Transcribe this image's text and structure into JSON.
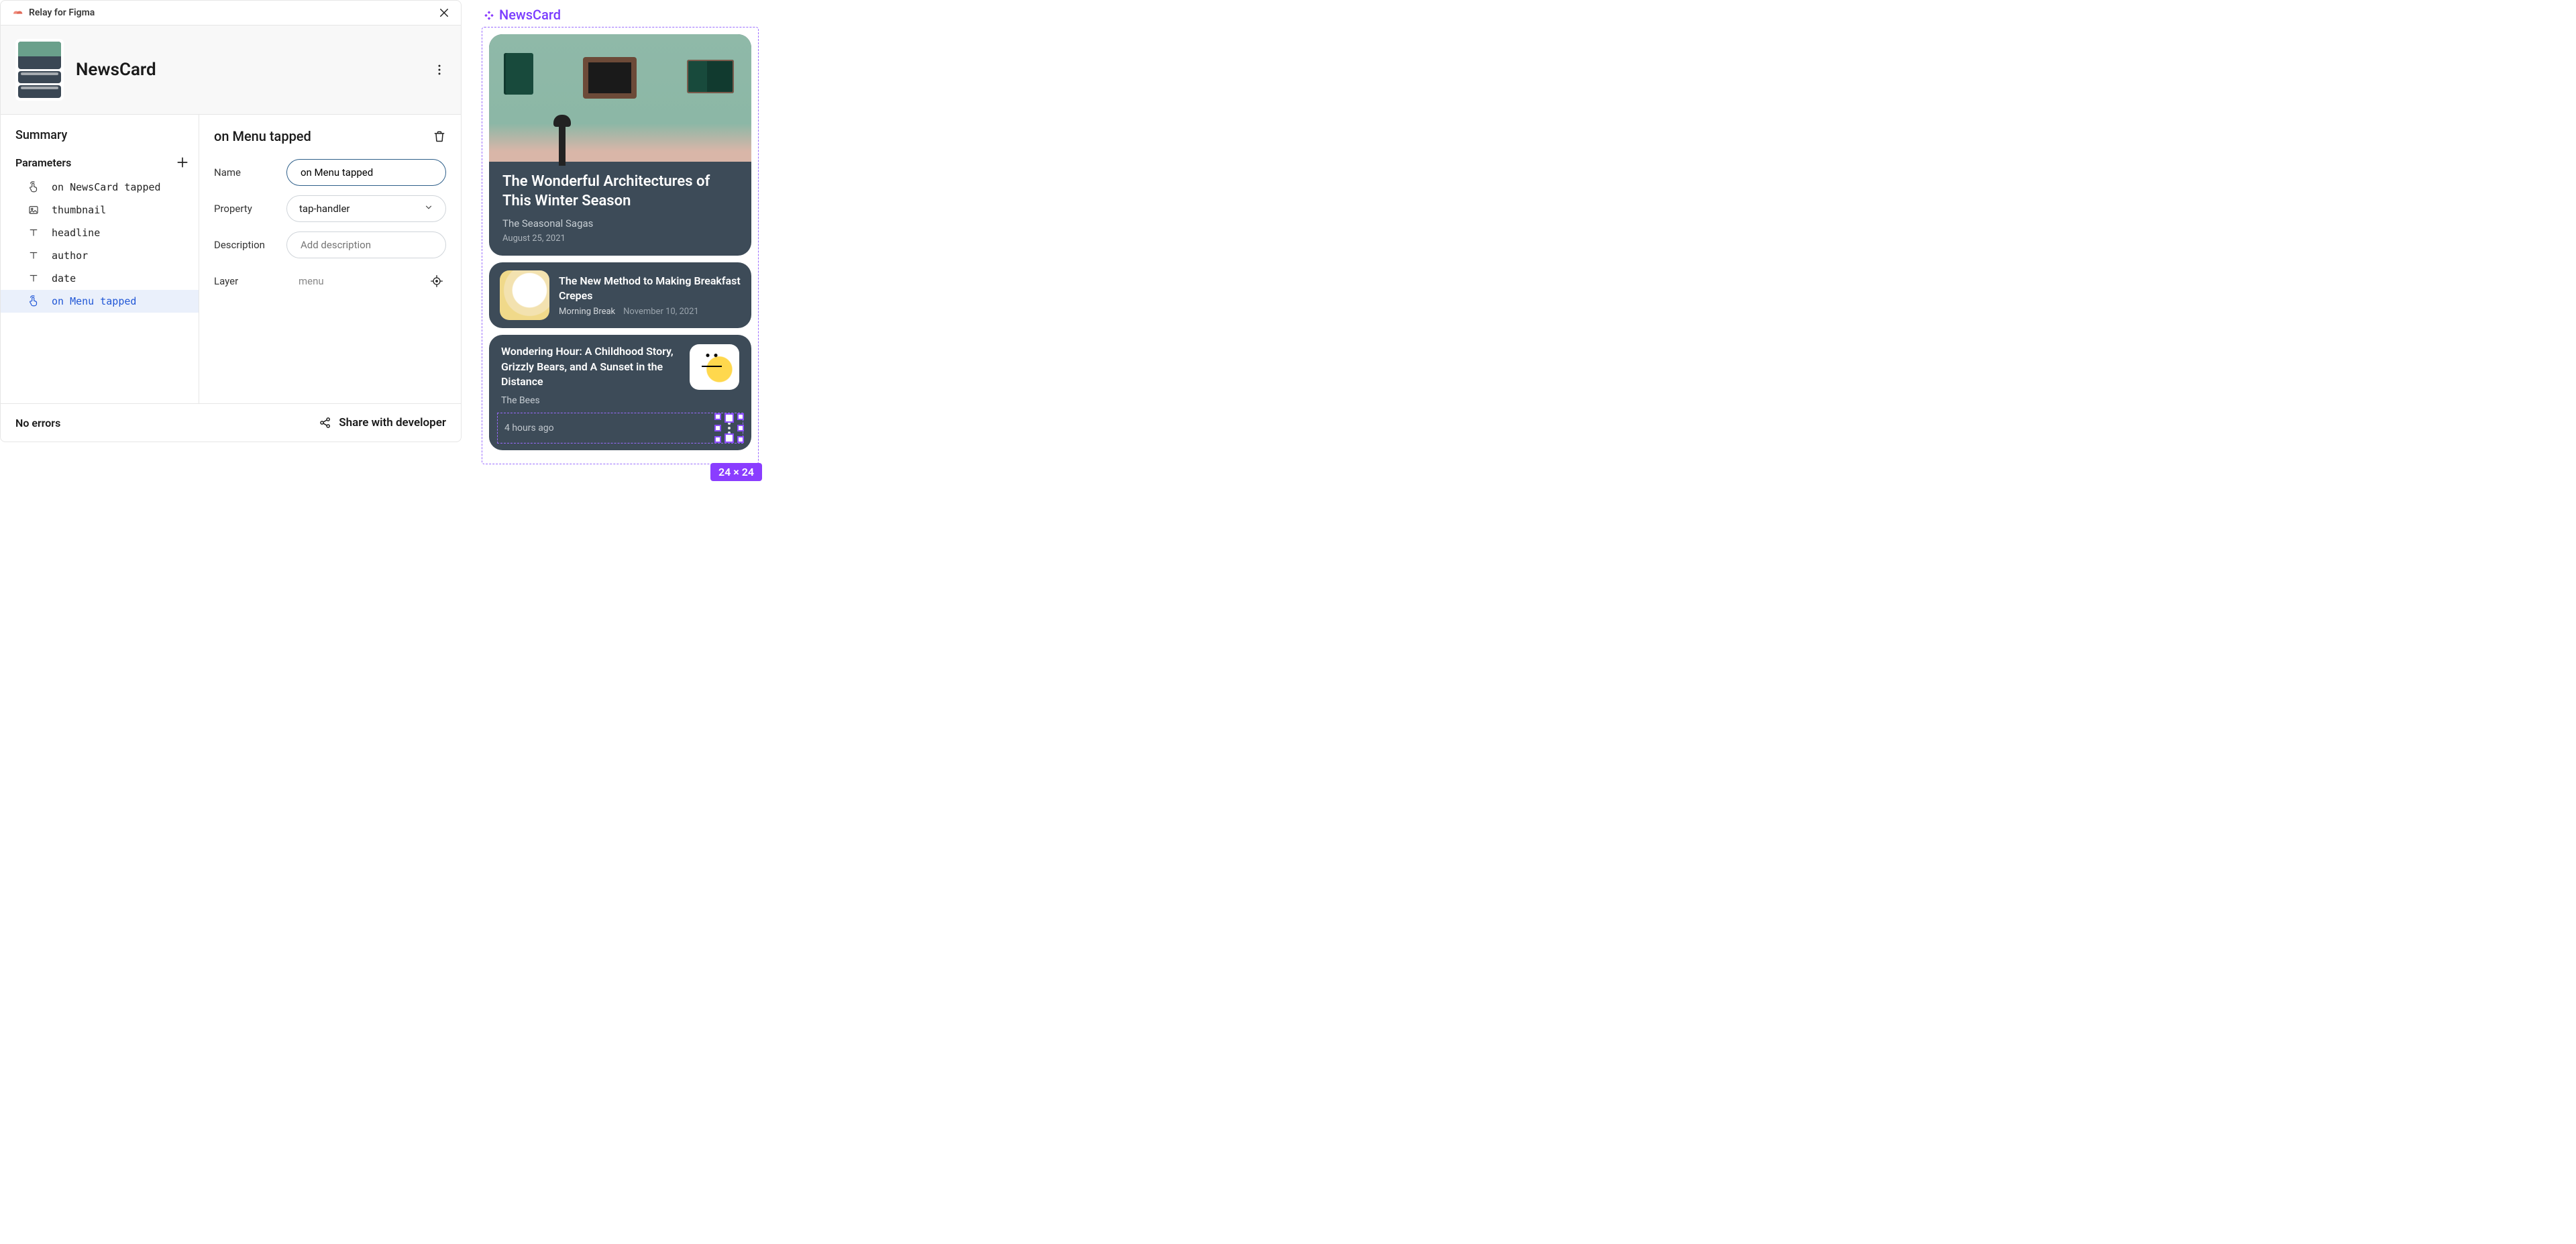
{
  "plugin": {
    "name": "Relay for Figma"
  },
  "component": {
    "name": "NewsCard"
  },
  "sidebar": {
    "summary_label": "Summary",
    "parameters_label": "Parameters",
    "params": [
      {
        "icon": "tap",
        "label": "on NewsCard tapped",
        "selected": false
      },
      {
        "icon": "image",
        "label": "thumbnail",
        "selected": false
      },
      {
        "icon": "text",
        "label": "headline",
        "selected": false
      },
      {
        "icon": "text",
        "label": "author",
        "selected": false
      },
      {
        "icon": "text",
        "label": "date",
        "selected": false
      },
      {
        "icon": "tap",
        "label": "on Menu tapped",
        "selected": true
      }
    ]
  },
  "detail": {
    "title": "on Menu tapped",
    "fields": {
      "name_label": "Name",
      "name_value": "on Menu tapped",
      "property_label": "Property",
      "property_value": "tap-handler",
      "description_label": "Description",
      "description_placeholder": "Add description",
      "layer_label": "Layer",
      "layer_value": "menu"
    }
  },
  "footer": {
    "status": "No errors",
    "share_label": "Share with developer"
  },
  "preview": {
    "frame_label": "NewsCard",
    "dims_badge": "24 × 24",
    "cards": {
      "hero": {
        "title": "The Wonderful Architectures of This Winter Season",
        "author": "The Seasonal Sagas",
        "date": "August 25, 2021"
      },
      "row1": {
        "title": "The New Method to Making Breakfast Crepes",
        "author": "Morning Break",
        "date": "November 10, 2021"
      },
      "row2": {
        "title": "Wondering Hour: A Childhood Story, Grizzly Bears, and A Sunset in the Distance",
        "author": "The Bees",
        "timeago": "4 hours ago"
      }
    }
  }
}
